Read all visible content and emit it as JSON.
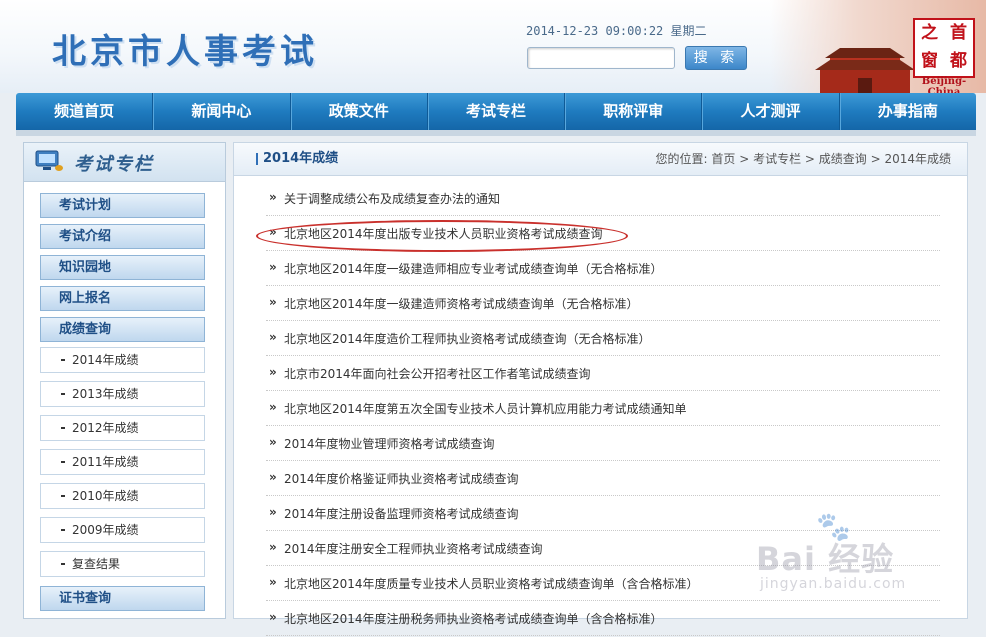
{
  "header": {
    "site_title": "北京市人事考试",
    "datetime": "2014-12-23 09:00:22 星期二",
    "search_button": "搜 索",
    "seal_chars": [
      "之",
      "首",
      "窗",
      "都"
    ],
    "seal_caption": "Beijing-China"
  },
  "nav": [
    "频道首页",
    "新闻中心",
    "政策文件",
    "考试专栏",
    "职称评审",
    "人才测评",
    "办事指南"
  ],
  "sidebar": {
    "title": "考试专栏",
    "menu": [
      "考试计划",
      "考试介绍",
      "知识园地",
      "网上报名",
      "成绩查询"
    ],
    "sub": [
      "2014年成绩",
      "2013年成绩",
      "2012年成绩",
      "2011年成绩",
      "2010年成绩",
      "2009年成绩",
      "复查结果"
    ],
    "bottom": "证书查询"
  },
  "main": {
    "title": "2014年成绩",
    "breadcrumb": "您的位置: 首页 > 考试专栏 > 成绩查询 > 2014年成绩",
    "items": [
      "关于调整成绩公布及成绩复查办法的通知",
      "北京地区2014年度出版专业技术人员职业资格考试成绩查询",
      "北京地区2014年度一级建造师相应专业考试成绩查询单（无合格标准）",
      "北京地区2014年度一级建造师资格考试成绩查询单（无合格标准）",
      "北京地区2014年度造价工程师执业资格考试成绩查询（无合格标准）",
      "北京市2014年面向社会公开招考社区工作者笔试成绩查询",
      "北京地区2014年度第五次全国专业技术人员计算机应用能力考试成绩通知单",
      "2014年度物业管理师资格考试成绩查询",
      "2014年度价格鉴证师执业资格考试成绩查询",
      "2014年度注册设备监理师资格考试成绩查询",
      "2014年度注册安全工程师执业资格考试成绩查询",
      "北京地区2014年度质量专业技术人员职业资格考试成绩查询单（含合格标准）",
      "北京地区2014年度注册税务师执业资格考试成绩查询单（含合格标准）"
    ]
  },
  "watermark": {
    "text": "Bai 经验",
    "url": "jingyan.baidu.com"
  }
}
